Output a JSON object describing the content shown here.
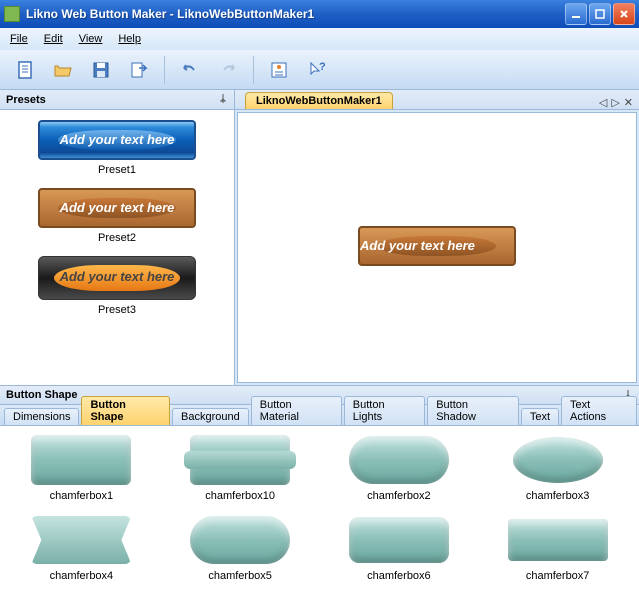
{
  "window": {
    "title": "Likno Web Button Maker - LiknoWebButtonMaker1"
  },
  "menu": {
    "file": "File",
    "edit": "Edit",
    "view": "View",
    "help": "Help"
  },
  "panels": {
    "presets_title": "Presets",
    "button_shape_title": "Button Shape"
  },
  "document": {
    "tab_name": "LiknoWebButtonMaker1"
  },
  "presets": [
    {
      "label": "Preset1",
      "text": "Add your text here",
      "style": "blue"
    },
    {
      "label": "Preset2",
      "text": "Add your text here",
      "style": "wood"
    },
    {
      "label": "Preset3",
      "text": "Add your text here",
      "style": "orange"
    }
  ],
  "canvas_button": {
    "text": "Add your text here"
  },
  "shape_tabs": [
    {
      "label": "Dimensions",
      "active": false
    },
    {
      "label": "Button Shape",
      "active": true
    },
    {
      "label": "Background",
      "active": false
    },
    {
      "label": "Button Material",
      "active": false
    },
    {
      "label": "Button Lights",
      "active": false
    },
    {
      "label": "Button Shadow",
      "active": false
    },
    {
      "label": "Text",
      "active": false
    },
    {
      "label": "Text Actions",
      "active": false
    }
  ],
  "shapes": [
    {
      "label": "chamferbox1"
    },
    {
      "label": "chamferbox10"
    },
    {
      "label": "chamferbox2"
    },
    {
      "label": "chamferbox3"
    },
    {
      "label": "chamferbox4"
    },
    {
      "label": "chamferbox5"
    },
    {
      "label": "chamferbox6"
    },
    {
      "label": "chamferbox7"
    }
  ]
}
